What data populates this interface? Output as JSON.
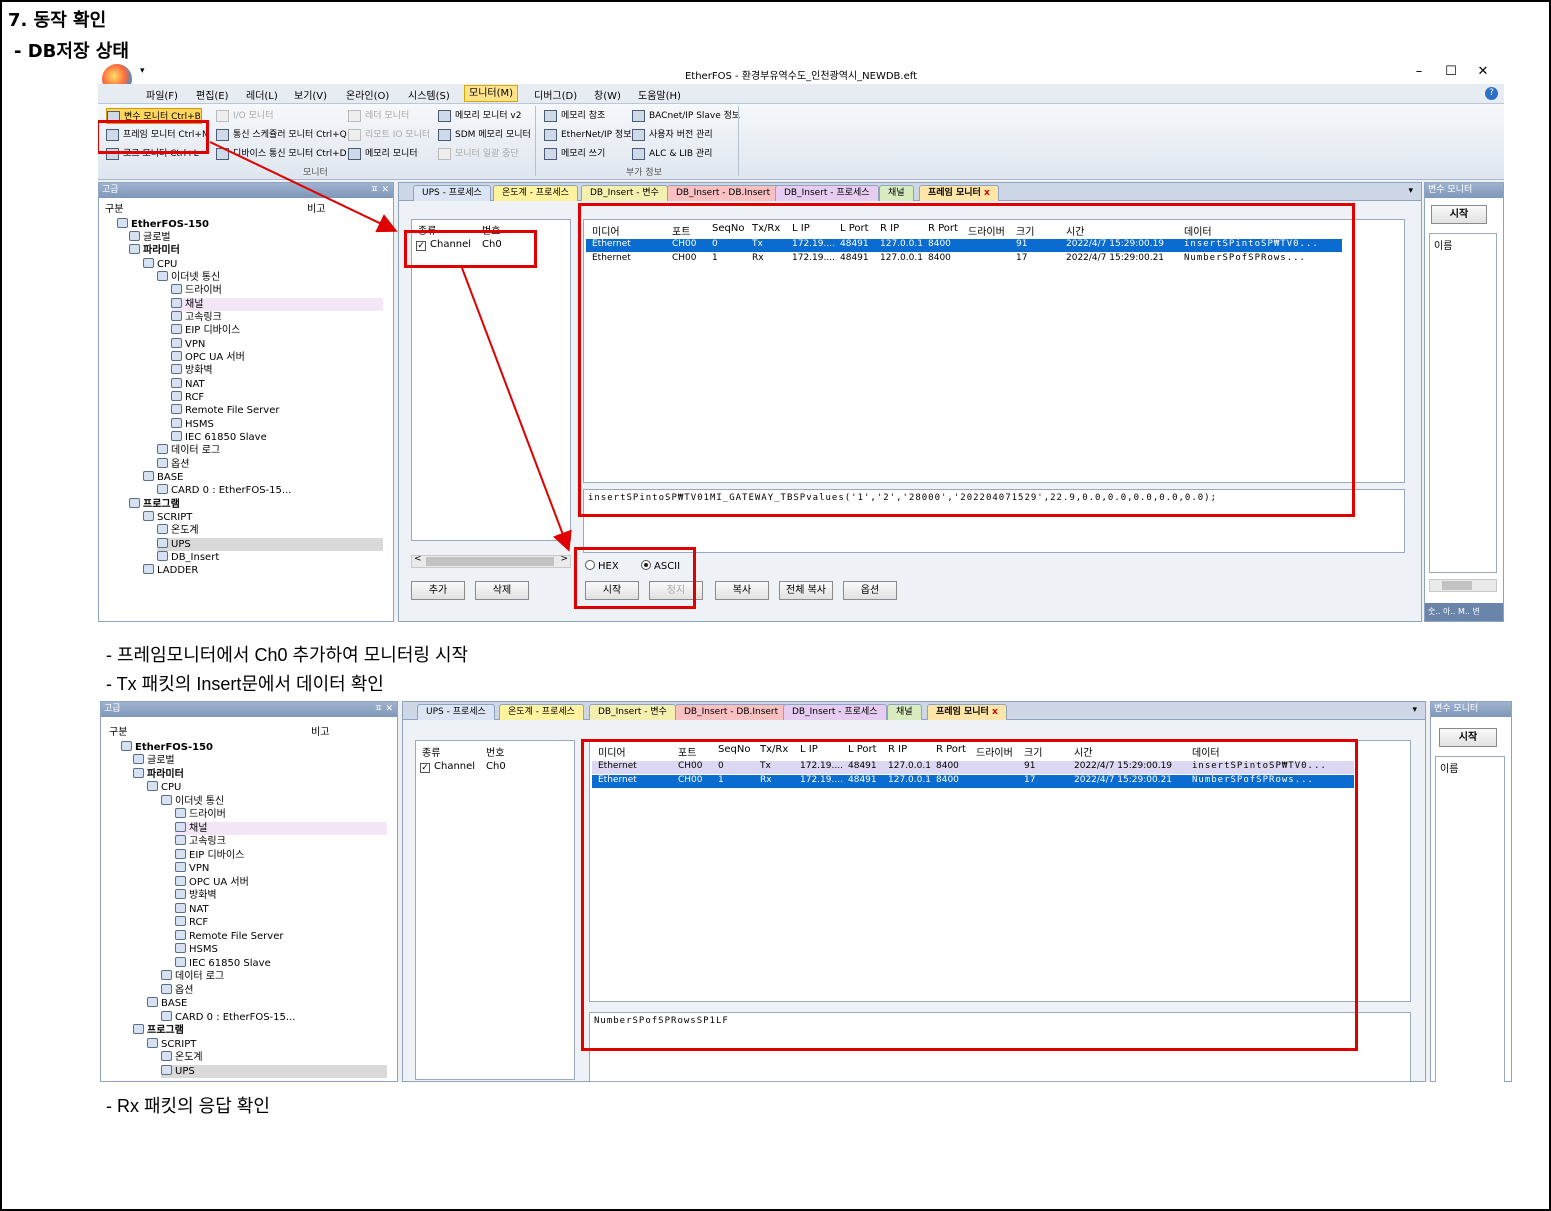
{
  "doc": {
    "heading": "7. 동작 확인",
    "subheading": "- DB저장 상태",
    "note1": "- 프레임모니터에서 Ch0 추가하여 모니터링 시작",
    "note2": "- Tx 패킷의 Insert문에서 데이터 확인",
    "note3": "- Rx 패킷의 응답 확인"
  },
  "app": {
    "title": "EtherFOS - 환경부유역수도_인천광역시_NEWDB.eft",
    "quick_access": "▾",
    "window_controls": [
      "–",
      "☐",
      "✕"
    ],
    "menus": [
      "파일(F)",
      "편집(E)",
      "레더(L)",
      "보기(V)",
      "온라인(O)",
      "시스템(S)",
      "모니터(M)",
      "디버그(D)",
      "창(W)",
      "도움말(H)"
    ],
    "active_menu": "모니터(M)",
    "help": "?"
  },
  "ribbon": {
    "monitor_group": {
      "label": "모니터",
      "items": [
        "변수 모니터 Ctrl+B",
        "프레임 모니터 Ctrl+M",
        "로그 모니터 Ctrl+L",
        "I/O 모니터",
        "통신 스케쥴러 모니터 Ctrl+Q",
        "디바이스 통신 모니터 Ctrl+D",
        "레더 모니터",
        "리모트 IO 모니터",
        "메모리 모니터",
        "메모리 모니터 v2",
        "SDM 메모리 모니터",
        "모니터 일괄 중단"
      ]
    },
    "extra_group": {
      "label": "부가 정보",
      "items": [
        "메모리 참조",
        "EtherNet/IP 정보",
        "메모리 쓰기",
        "BACnet/IP Slave 정보",
        "사용자 버전 관리",
        "ALC & LIB 관리"
      ]
    }
  },
  "tree_panel": {
    "title": "고급",
    "col_name": "구분",
    "col_note": "비고",
    "pin": "ㅍ ✕",
    "items": [
      "EtherFOS-150",
      "글로벌",
      "파라미터",
      "CPU",
      "이더넷 통신",
      "드라이버",
      "채널",
      "고속링크",
      "EIP 디바이스",
      "VPN",
      "OPC UA 서버",
      "방화벽",
      "NAT",
      "RCF",
      "Remote File Server",
      "HSMS",
      "IEC 61850 Slave",
      "데이터 로그",
      "옵션",
      "BASE",
      "CARD 0 : EtherFOS-15...",
      "프로그램",
      "SCRIPT",
      "온도계",
      "UPS",
      "DB_Insert",
      "LADDER"
    ]
  },
  "tabs": [
    "UPS - 프로세스",
    "온도계 - 프로세스",
    "DB_Insert - 변수",
    "DB_Insert - DB.Insert",
    "DB_Insert - 프로세스",
    "채널",
    "프레임 모니터"
  ],
  "tab_close": "x",
  "tab_dropdown": "▾",
  "channel_list": {
    "headers": [
      "종류",
      "번호"
    ],
    "row": {
      "kind": "Channel",
      "num": "Ch0",
      "checked": "✓"
    },
    "add": "추가",
    "delete": "삭제"
  },
  "frame_table": {
    "headers": [
      "미디어",
      "포트",
      "SeqNo",
      "Tx/Rx",
      "L IP",
      "L Port",
      "R IP",
      "R Port",
      "드라이버",
      "크기",
      "시간",
      "데이터"
    ],
    "rows": [
      [
        "Ethernet",
        "CH00",
        "0",
        "Tx",
        "172.19....",
        "48491",
        "127.0.0.1",
        "8400",
        "",
        "91",
        "2022/4/7 15:29:00.19",
        "insertSPintoSP₩TV0..."
      ],
      [
        "Ethernet",
        "CH00",
        "1",
        "Rx",
        "172.19....",
        "48491",
        "127.0.0.1",
        "8400",
        "",
        "17",
        "2022/4/7 15:29:00.21",
        "NumberSPofSPRows..."
      ]
    ]
  },
  "detail1": "insertSPintoSP₩TV01MI_GATEWAY_TBSPvalues('1','2','28000','202204071529',22.9,0.0,0.0,0.0,0.0,0.0);",
  "detail2": "NumberSPofSPRowsSP1LF",
  "controls": {
    "hex": "HEX",
    "ascii": "ASCII",
    "start": "시작",
    "stop": "정지",
    "copy": "복사",
    "copy_all": "전체 복사",
    "options": "옵션"
  },
  "var_monitor": {
    "title": "변수 모니터",
    "start": "시작",
    "col_name": "이름",
    "bottom_tabs": "숫.. 아.. M.. 변"
  },
  "colors": {
    "accent_red": "#e00000",
    "selection_blue": "#0a6bd1",
    "alt_row": "#dcd8f3"
  }
}
